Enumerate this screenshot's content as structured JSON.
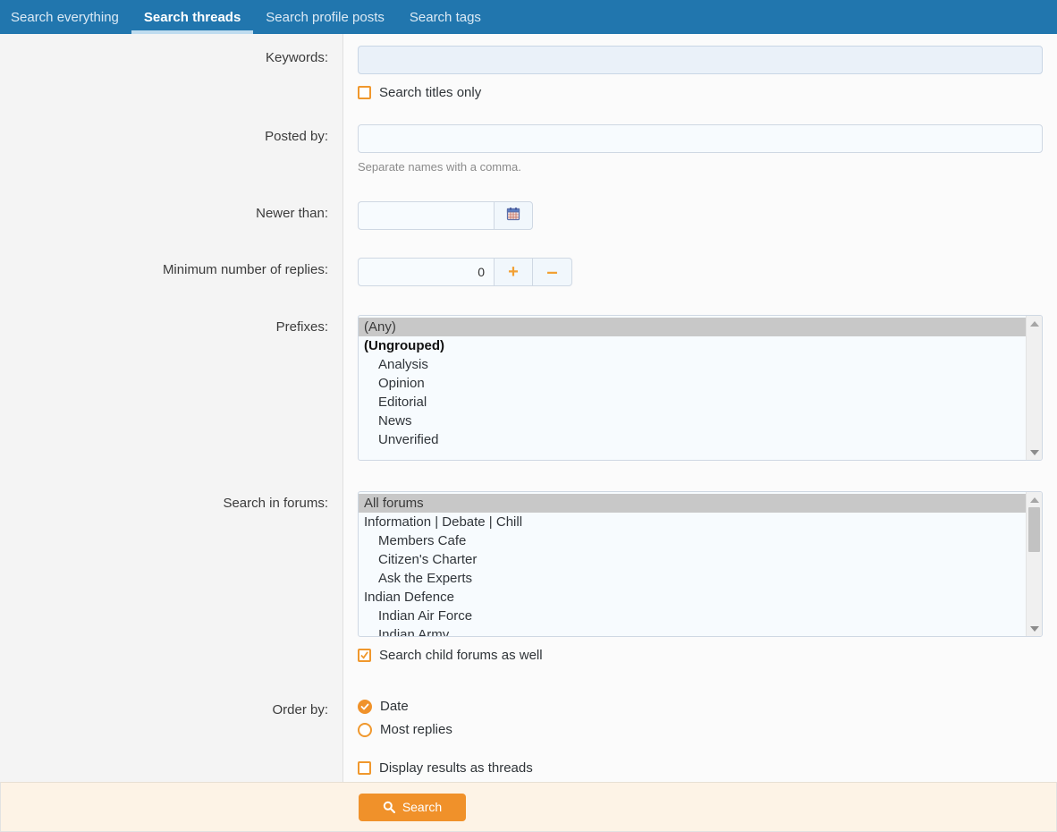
{
  "tabs": [
    {
      "label": "Search everything",
      "active": false
    },
    {
      "label": "Search threads",
      "active": true
    },
    {
      "label": "Search profile posts",
      "active": false
    },
    {
      "label": "Search tags",
      "active": false
    }
  ],
  "form": {
    "keywords": {
      "label": "Keywords:",
      "value": "",
      "placeholder": "",
      "titles_only": {
        "label": "Search titles only",
        "checked": false
      }
    },
    "posted_by": {
      "label": "Posted by:",
      "value": "",
      "placeholder": "",
      "hint": "Separate names with a comma."
    },
    "newer_than": {
      "label": "Newer than:",
      "value": "",
      "placeholder": "",
      "picker_icon": "calendar-icon"
    },
    "min_replies": {
      "label": "Minimum number of replies:",
      "value": "0",
      "increment_icon": "plus-icon",
      "decrement_icon": "minus-icon"
    },
    "prefixes": {
      "label": "Prefixes:",
      "options": [
        {
          "text": "(Any)",
          "selected": true,
          "bold": false,
          "indent": 0
        },
        {
          "text": "(Ungrouped)",
          "selected": false,
          "bold": true,
          "indent": 0
        },
        {
          "text": "Analysis",
          "selected": false,
          "bold": false,
          "indent": 1
        },
        {
          "text": "Opinion",
          "selected": false,
          "bold": false,
          "indent": 1
        },
        {
          "text": "Editorial",
          "selected": false,
          "bold": false,
          "indent": 1
        },
        {
          "text": "News",
          "selected": false,
          "bold": false,
          "indent": 1
        },
        {
          "text": "Unverified",
          "selected": false,
          "bold": false,
          "indent": 1
        }
      ]
    },
    "search_in_forums": {
      "label": "Search in forums:",
      "options": [
        {
          "text": "All forums",
          "selected": true,
          "indent": 0
        },
        {
          "text": "Information | Debate | Chill",
          "selected": false,
          "indent": 0
        },
        {
          "text": "Members Cafe",
          "selected": false,
          "indent": 1
        },
        {
          "text": "Citizen's Charter",
          "selected": false,
          "indent": 1
        },
        {
          "text": "Ask the Experts",
          "selected": false,
          "indent": 1
        },
        {
          "text": "Indian Defence",
          "selected": false,
          "indent": 0
        },
        {
          "text": "Indian Air Force",
          "selected": false,
          "indent": 1
        },
        {
          "text": "Indian Army",
          "selected": false,
          "indent": 1
        }
      ],
      "child_forums": {
        "label": "Search child forums as well",
        "checked": true
      }
    },
    "order_by": {
      "label": "Order by:",
      "options": [
        {
          "label": "Date",
          "selected": true
        },
        {
          "label": "Most replies",
          "selected": false
        }
      ]
    },
    "display_as_threads": {
      "label": "Display results as threads",
      "checked": false
    }
  },
  "footer": {
    "search_button": {
      "label": "Search",
      "icon": "magnifier-icon"
    }
  },
  "colors": {
    "tabbar_blue": "#2176ae",
    "accent_orange": "#f0912a",
    "footer_bg": "#fdf3e6",
    "label_col_bg": "#f4f4f4",
    "field_bg": "#f7fbfe",
    "selected_option_bg": "#c8c8c8"
  }
}
